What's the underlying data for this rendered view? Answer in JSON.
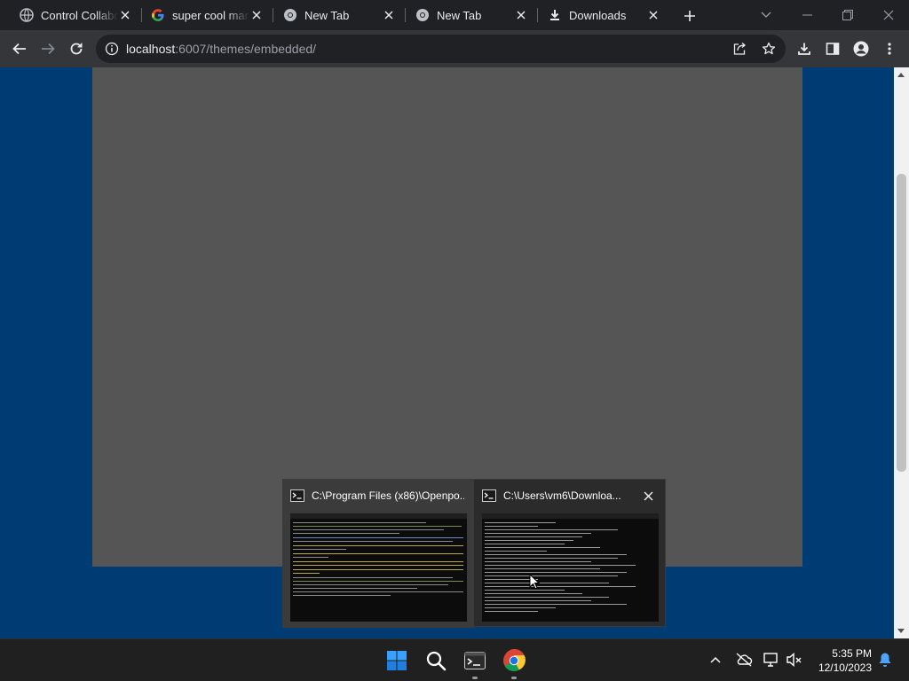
{
  "browser": {
    "tabs": [
      {
        "title": "Control Collaboration",
        "favicon": "globe-icon"
      },
      {
        "title": "super cool markdown",
        "favicon": "google-icon"
      },
      {
        "title": "New Tab",
        "favicon": "chrome-icon"
      },
      {
        "title": "New Tab",
        "favicon": "chrome-icon"
      },
      {
        "title": "Downloads",
        "favicon": "download-icon"
      }
    ],
    "active_tab_index": 0,
    "address": {
      "host": "localhost",
      "rest": ":6007/themes/embedded/"
    }
  },
  "colors": {
    "page_background": "#003c74",
    "embedded_panel": "#555555",
    "tab_strip": "#202124",
    "toolbar": "#35363a"
  },
  "thumbnails": [
    {
      "title": "C:\\Program Files (x86)\\Openpo...",
      "icon": "terminal-icon"
    },
    {
      "title": "C:\\Users\\vm6\\Downloa...",
      "icon": "terminal-icon"
    }
  ],
  "taskbar": {
    "apps": [
      "start-icon",
      "search-icon",
      "terminal-icon",
      "chrome-icon"
    ],
    "time": "5:35 PM",
    "date": "12/10/2023"
  }
}
